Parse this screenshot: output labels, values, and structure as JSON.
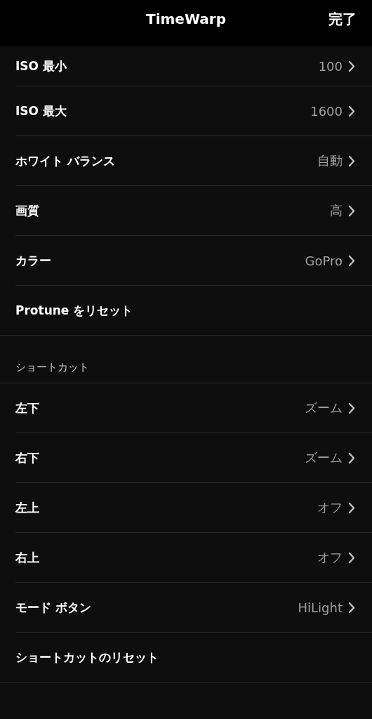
{
  "nav_bar": {
    "title": "TimeWarp",
    "done_button": "完了"
  },
  "sections": [
    {
      "items": [
        {
          "kind": "link",
          "label": "ISO 最小",
          "value": "100"
        },
        {
          "kind": "link",
          "label": "ISO 最大",
          "value": "1600"
        },
        {
          "kind": "link",
          "label": "ホワイト バランス",
          "value": "自動"
        },
        {
          "kind": "link",
          "label": "画質",
          "value": "高"
        },
        {
          "kind": "link",
          "label": "カラー",
          "value": "GoPro"
        },
        {
          "kind": "action",
          "label": "Protune をリセット"
        }
      ]
    },
    {
      "header": "ショートカット",
      "items": [
        {
          "kind": "link",
          "label": "左下",
          "value": "ズーム"
        },
        {
          "kind": "link",
          "label": "右下",
          "value": "ズーム"
        },
        {
          "kind": "link",
          "label": "左上",
          "value": "オフ"
        },
        {
          "kind": "link",
          "label": "右上",
          "value": "オフ"
        },
        {
          "kind": "link",
          "label": "モード ボタン",
          "value": "HiLight"
        },
        {
          "kind": "action",
          "label": "ショートカットのリセット"
        }
      ]
    }
  ]
}
